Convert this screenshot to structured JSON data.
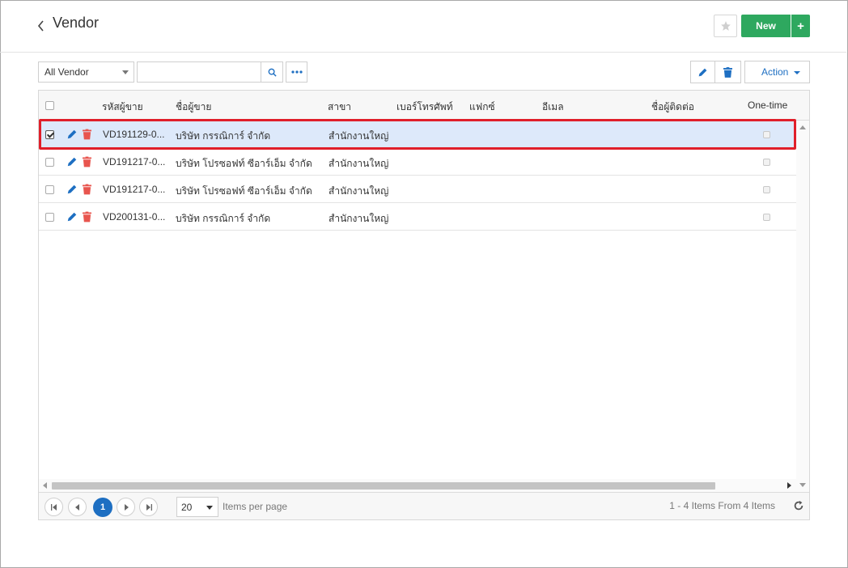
{
  "header": {
    "title": "Vendor",
    "new_label": "New",
    "new_plus_label": "+"
  },
  "toolbar": {
    "filter_selected": "All Vendor",
    "search_value": "",
    "search_placeholder": "",
    "action_label": "Action"
  },
  "grid": {
    "columns": [
      "รหัสผู้ขาย",
      "ชื่อผู้ขาย",
      "สาขา",
      "เบอร์โทรศัพท์",
      "แฟกซ์",
      "อีเมล",
      "ชื่อผู้ติดต่อ",
      "One-time"
    ],
    "rows": [
      {
        "code": "VD191129-0...",
        "name": "บริษัท กรรณิการ์ จำกัด",
        "branch": "สำนักงานใหญ่",
        "phone": "",
        "fax": "",
        "email": "",
        "contact": "",
        "selected": true
      },
      {
        "code": "VD191217-0...",
        "name": "บริษัท โปรซอฟท์ ซีอาร์เอ็ม จำกัด",
        "branch": "สำนักงานใหญ่",
        "phone": "",
        "fax": "",
        "email": "",
        "contact": "",
        "selected": false
      },
      {
        "code": "VD191217-0...",
        "name": "บริษัท โปรซอฟท์ ซีอาร์เอ็ม จำกัด",
        "branch": "สำนักงานใหญ่",
        "phone": "",
        "fax": "",
        "email": "",
        "contact": "",
        "selected": false
      },
      {
        "code": "VD200131-0...",
        "name": "บริษัท กรรณิการ์ จำกัด",
        "branch": "สำนักงานใหญ่",
        "phone": "",
        "fax": "",
        "email": "",
        "contact": "",
        "selected": false
      }
    ]
  },
  "pager": {
    "current_page": "1",
    "page_size": "20",
    "per_page_label": "Items per page",
    "items_info": "1 - 4 Items From 4 Items"
  },
  "colors": {
    "accent_green": "#2ea85f",
    "accent_blue": "#1e6fc2",
    "delete_red": "#e8554e",
    "highlight_red": "#e01f2a",
    "selected_row": "#dde9fa"
  },
  "icons": [
    "back-icon",
    "star-icon",
    "search-icon",
    "more-dots-icon",
    "pencil-icon",
    "trash-icon",
    "first-page-icon",
    "prev-page-icon",
    "next-page-icon",
    "last-page-icon",
    "refresh-icon"
  ]
}
